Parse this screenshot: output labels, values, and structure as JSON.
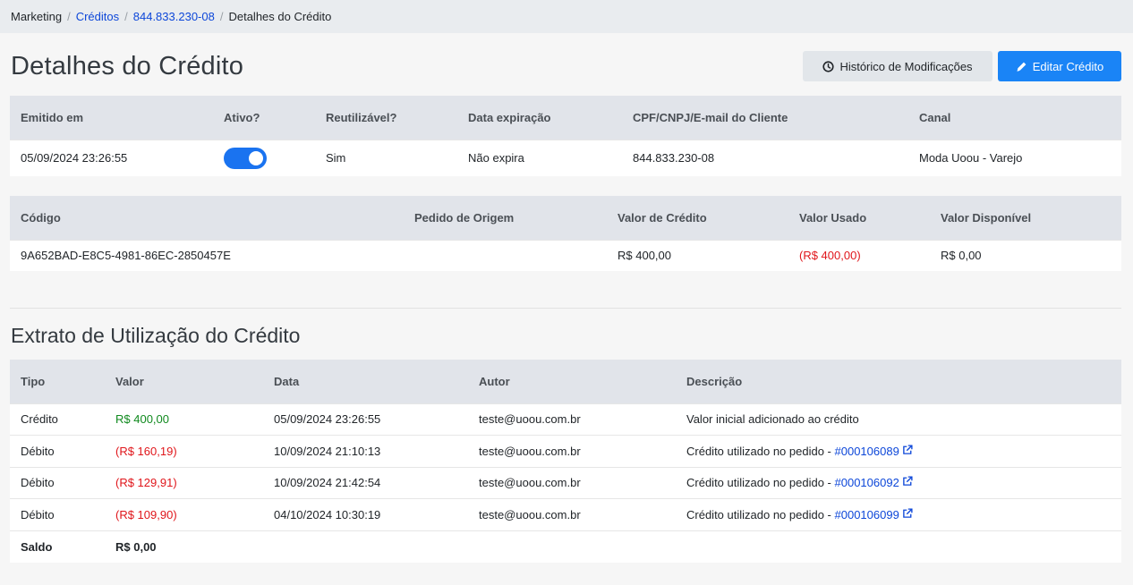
{
  "breadcrumb": {
    "items": [
      "Marketing",
      "Créditos",
      "844.833.230-08",
      "Detalhes do Crédito"
    ]
  },
  "page_title": "Detalhes do Crédito",
  "actions": {
    "history_label": "Histórico de Modificações",
    "edit_label": "Editar Crédito"
  },
  "summary": {
    "headers": [
      "Emitido em",
      "Ativo?",
      "Reutilizável?",
      "Data expiração",
      "CPF/CNPJ/E-mail do Cliente",
      "Canal"
    ],
    "issued_at": "05/09/2024 23:26:55",
    "active": true,
    "reusable": "Sim",
    "expiration": "Não expira",
    "customer": "844.833.230-08",
    "channel": "Moda Uoou - Varejo"
  },
  "values": {
    "headers": [
      "Código",
      "Pedido de Origem",
      "Valor de Crédito",
      "Valor Usado",
      "Valor Disponível"
    ],
    "code": "9A652BAD-E8C5-4981-86EC-2850457E",
    "origin_order": "",
    "credit_value": "R$ 400,00",
    "used_value": "(R$ 400,00)",
    "available_value": "R$ 0,00"
  },
  "statement": {
    "title": "Extrato de Utilização do Crédito",
    "headers": [
      "Tipo",
      "Valor",
      "Data",
      "Autor",
      "Descrição"
    ],
    "rows": [
      {
        "type": "Crédito",
        "value": "R$ 400,00",
        "date": "05/09/2024 23:26:55",
        "author": "teste@uoou.com.br",
        "description": "Valor inicial adicionado ao crédito",
        "order": ""
      },
      {
        "type": "Débito",
        "value": "(R$ 160,19)",
        "date": "10/09/2024 21:10:13",
        "author": "teste@uoou.com.br",
        "description": "Crédito utilizado no pedido - ",
        "order": "#000106089"
      },
      {
        "type": "Débito",
        "value": "(R$ 129,91)",
        "date": "10/09/2024 21:42:54",
        "author": "teste@uoou.com.br",
        "description": "Crédito utilizado no pedido - ",
        "order": "#000106092"
      },
      {
        "type": "Débito",
        "value": "(R$ 109,90)",
        "date": "04/10/2024 10:30:19",
        "author": "teste@uoou.com.br",
        "description": "Crédito utilizado no pedido - ",
        "order": "#000106099"
      }
    ],
    "balance_label": "Saldo",
    "balance_value": "R$ 0,00"
  },
  "colors": {
    "primary": "#1a84f6",
    "positive": "#118a1f",
    "negative": "#e0161b",
    "link": "#0d47d9"
  }
}
